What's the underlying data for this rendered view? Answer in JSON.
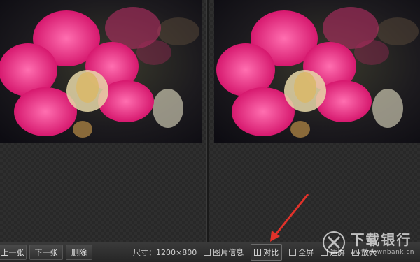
{
  "toolbar": {
    "prev_label": "上一张",
    "next_label": "下一张",
    "delete_label": "删除",
    "size_label": "尺寸：",
    "size_value": "1200×800",
    "info_label": "图片信息",
    "compare_label": "对比",
    "fullscreen_label": "全屏",
    "fit_label": "适屏",
    "zoom_label": "放大"
  },
  "watermark": {
    "main": "下载银行",
    "sub": "www.downbank.cn"
  },
  "colors": {
    "arrow": "#e0322a",
    "flower": "#e8257c"
  },
  "icons": [
    "image-info-icon",
    "compare-icon",
    "fullscreen-icon",
    "fit-screen-icon",
    "zoom-icon"
  ]
}
